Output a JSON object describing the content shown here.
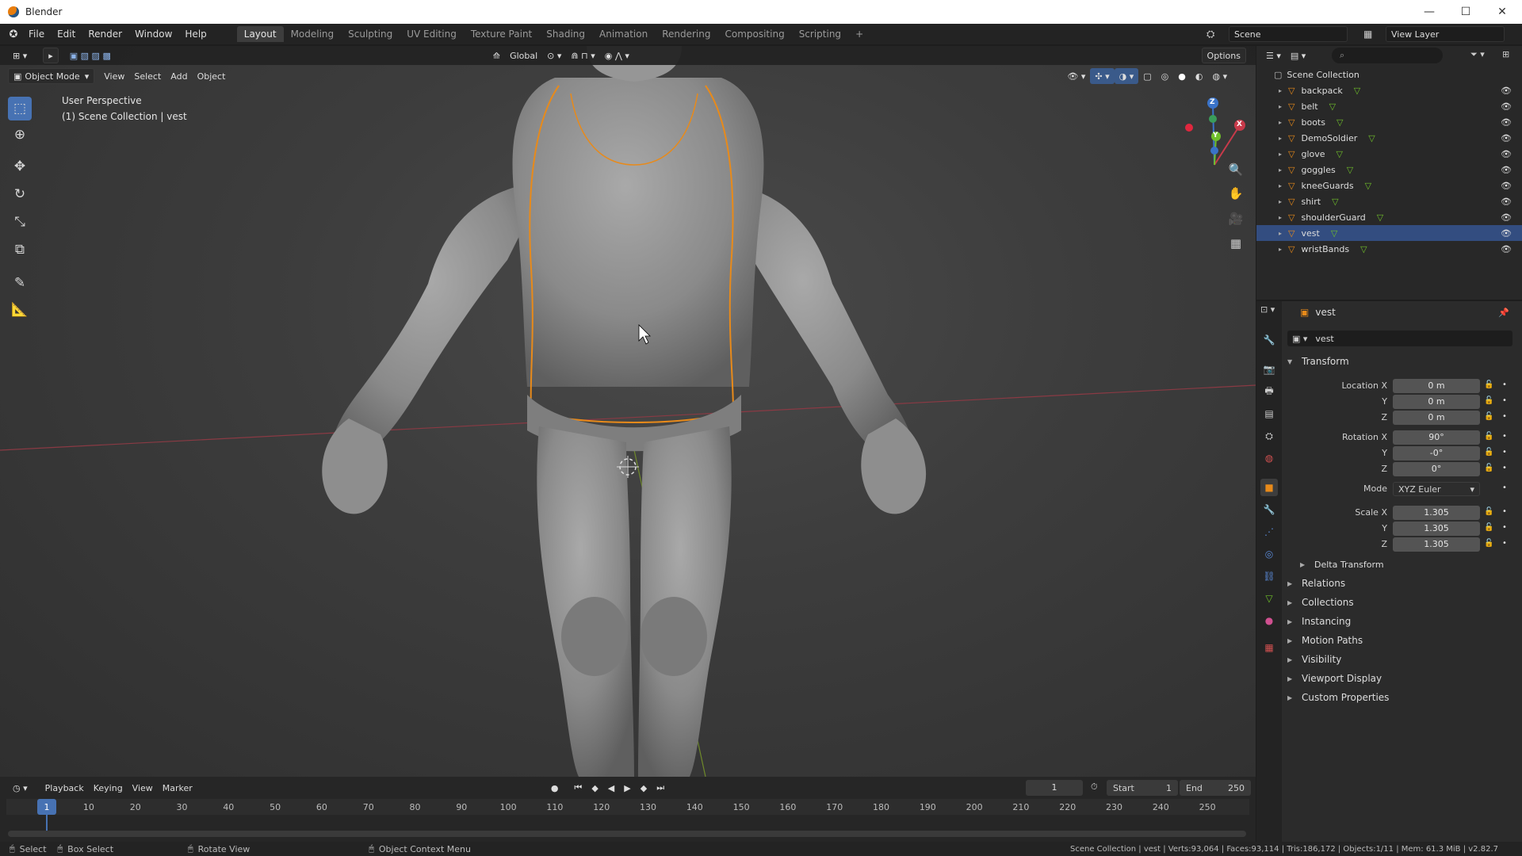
{
  "window": {
    "title": "Blender",
    "minimize": "—",
    "maximize": "☐",
    "close": "✕"
  },
  "menubar": {
    "menus": [
      "File",
      "Edit",
      "Render",
      "Window",
      "Help"
    ],
    "workspaces": [
      "Layout",
      "Modeling",
      "Sculpting",
      "UV Editing",
      "Texture Paint",
      "Shading",
      "Animation",
      "Rendering",
      "Compositing",
      "Scripting"
    ],
    "add_workspace": "+",
    "scene": "Scene",
    "view_layer": "View Layer"
  },
  "viewport": {
    "mode": "Object Mode",
    "menus": [
      "View",
      "Select",
      "Add",
      "Object"
    ],
    "orientation": "Global",
    "options": "Options",
    "overlay_perspective": "User Perspective",
    "overlay_collection": "(1) Scene Collection | vest",
    "gizmo": {
      "z": "Z",
      "x": "X",
      "y": "Y"
    }
  },
  "outliner": {
    "root": "Scene Collection",
    "items": [
      {
        "name": "backpack"
      },
      {
        "name": "belt"
      },
      {
        "name": "boots"
      },
      {
        "name": "DemoSoldier"
      },
      {
        "name": "glove"
      },
      {
        "name": "goggles"
      },
      {
        "name": "kneeGuards"
      },
      {
        "name": "shirt"
      },
      {
        "name": "shoulderGuard"
      },
      {
        "name": "vest",
        "selected": true
      },
      {
        "name": "wristBands"
      }
    ]
  },
  "properties": {
    "object_name": "vest",
    "datablock": "vest",
    "transform_title": "Transform",
    "location": {
      "label": "Location X",
      "x": "0 m",
      "y": "0 m",
      "z": "0 m"
    },
    "rotation": {
      "label": "Rotation X",
      "x": "90°",
      "y": "-0°",
      "z": "0°"
    },
    "mode_label": "Mode",
    "mode_value": "XYZ Euler",
    "scale": {
      "label": "Scale X",
      "x": "1.305",
      "y": "1.305",
      "z": "1.305"
    },
    "axis_y": "Y",
    "axis_z": "Z",
    "delta": "Delta Transform",
    "panels": [
      "Relations",
      "Collections",
      "Instancing",
      "Motion Paths",
      "Visibility",
      "Viewport Display",
      "Custom Properties"
    ]
  },
  "timeline": {
    "menus": [
      "Playback",
      "Keying",
      "View",
      "Marker"
    ],
    "current_frame": "1",
    "start_label": "Start",
    "start": "1",
    "end_label": "End",
    "end": "250",
    "ticks": [
      "1",
      "10",
      "20",
      "30",
      "40",
      "50",
      "60",
      "70",
      "80",
      "90",
      "100",
      "110",
      "120",
      "130",
      "140",
      "150",
      "160",
      "170",
      "180",
      "190",
      "200",
      "210",
      "220",
      "230",
      "240",
      "250"
    ]
  },
  "statusbar": {
    "select": "Select",
    "box_select": "Box Select",
    "rotate_view": "Rotate View",
    "context_menu": "Object Context Menu",
    "stats": "Scene Collection | vest | Verts:93,064 | Faces:93,114 | Tris:186,172 | Objects:1/11 | Mem: 61.3 MiB | v2.82.7"
  },
  "colors": {
    "accent": "#4772b3",
    "selection": "#e88a1a",
    "active_row": "#334d80"
  }
}
